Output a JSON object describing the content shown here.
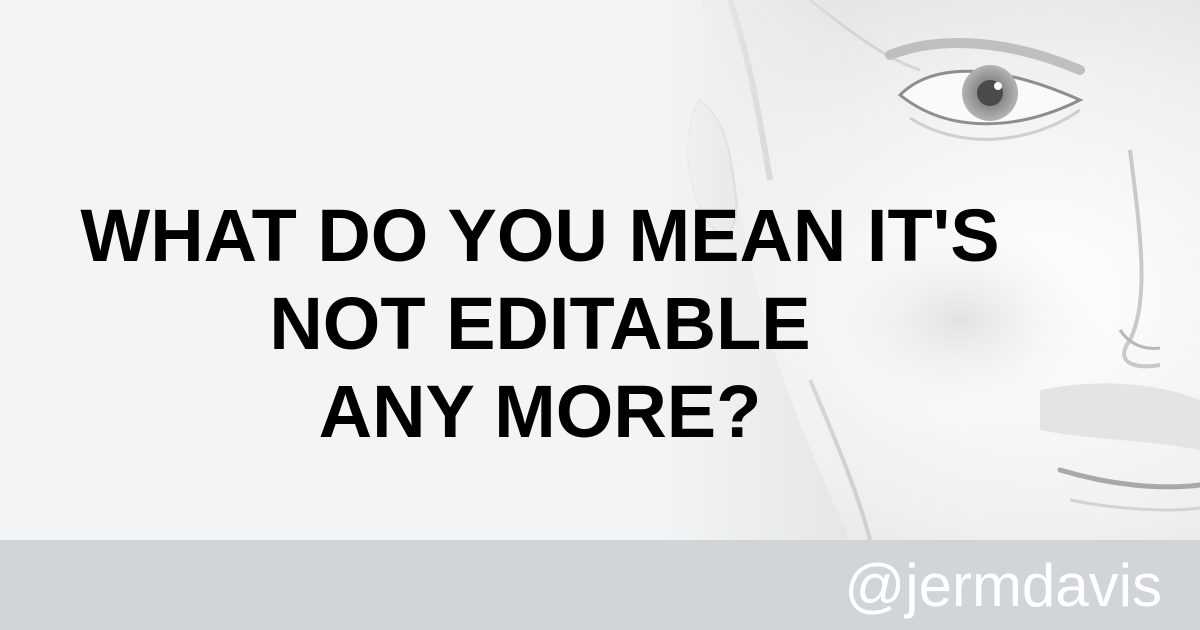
{
  "headline": {
    "line1": "WHAT DO YOU MEAN IT'S",
    "line2": "NOT EDITABLE",
    "line3": "ANY MORE?"
  },
  "footer": {
    "handle": "@jermdavis"
  },
  "colors": {
    "background": "#f3f4f5",
    "footer_bar": "#d1d4d8",
    "headline_text": "#000000",
    "handle_text": "#ffffff"
  }
}
